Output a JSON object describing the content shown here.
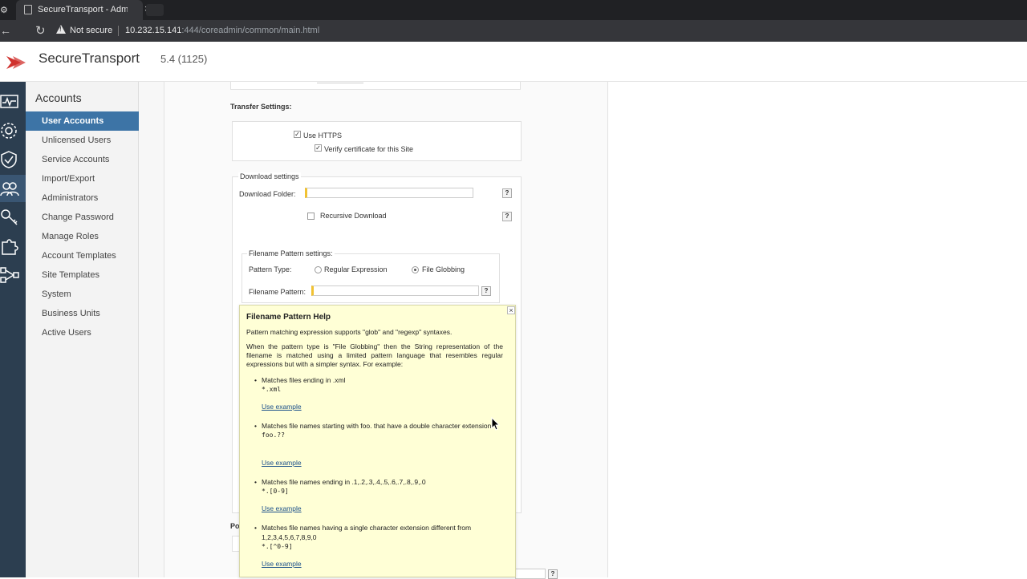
{
  "browser": {
    "tab_title": "SecureTransport - Admin",
    "tab_close": "×",
    "security_label": "Not secure",
    "url_host": "10.232.15.141",
    "url_rest": ":444/coreadmin/common/main.html"
  },
  "app": {
    "name": "SecureTransport",
    "version": "5.4 (1125)",
    "brand_color": "#d0312d"
  },
  "rail": {
    "icons": [
      "monitor-icon",
      "settings-gear-icon",
      "shield-check-icon",
      "users-icon",
      "key-icon",
      "puzzle-icon",
      "flow-icon"
    ],
    "active": "users-icon"
  },
  "sidebar": {
    "title": "Accounts",
    "items": [
      {
        "label": "User Accounts",
        "active": true
      },
      {
        "label": "Unlicensed Users"
      },
      {
        "label": "Service Accounts"
      },
      {
        "label": "Import/Export"
      },
      {
        "label": "Administrators"
      },
      {
        "label": "Change Password"
      },
      {
        "label": "Manage Roles"
      },
      {
        "label": "Account Templates"
      },
      {
        "label": "Site Templates"
      },
      {
        "label": "System"
      },
      {
        "label": "Business Units"
      },
      {
        "label": "Active Users"
      }
    ]
  },
  "form": {
    "transfer_settings_label": "Transfer Settings:",
    "use_https_label": "Use HTTPS",
    "use_https_checked": true,
    "verify_cert_label": "Verify certificate for this Site",
    "verify_cert_checked": true,
    "download_settings_label": "Download settings",
    "download_folder_label": "Download Folder:",
    "download_folder_value": "",
    "recursive_download_label": "Recursive Download",
    "recursive_download_checked": false,
    "filename_pattern_settings_label": "Filename Pattern settings:",
    "pattern_type_label": "Pattern Type:",
    "pattern_regex_label": "Regular Expression",
    "pattern_glob_label": "File Globbing",
    "pattern_selected": "File Globbing",
    "filename_pattern_label": "Filename Pattern:",
    "filename_pattern_value": "",
    "help_symbol": "?",
    "partial_label": "Po"
  },
  "help_popup": {
    "title": "Filename Pattern Help",
    "close": "×",
    "intro": "Pattern matching expression supports \"glob\" and \"regexp\" syntaxes.",
    "desc": "When the pattern type is \"File Globbing\" then the String representation of the filename is matched using a limited pattern language that resembles regular expressions but with a simpler syntax. For example:",
    "examples": [
      {
        "text": "Matches files ending in .xml",
        "pattern": "*.xml",
        "link": "Use example"
      },
      {
        "text": "Matches file names starting with foo. that have a double character extension",
        "pattern": "foo.??",
        "link": "Use example"
      },
      {
        "text": "Matches file names ending in .1,.2,.3,.4,.5,.6,.7,.8,.9,.0",
        "pattern": "*.[0-9]",
        "link": "Use example"
      },
      {
        "text": "Matches file names having a single character extension different from 1,2,3,4,5,6,7,8,9,0",
        "pattern": "*.[^0-9]",
        "link": "Use example"
      }
    ]
  }
}
